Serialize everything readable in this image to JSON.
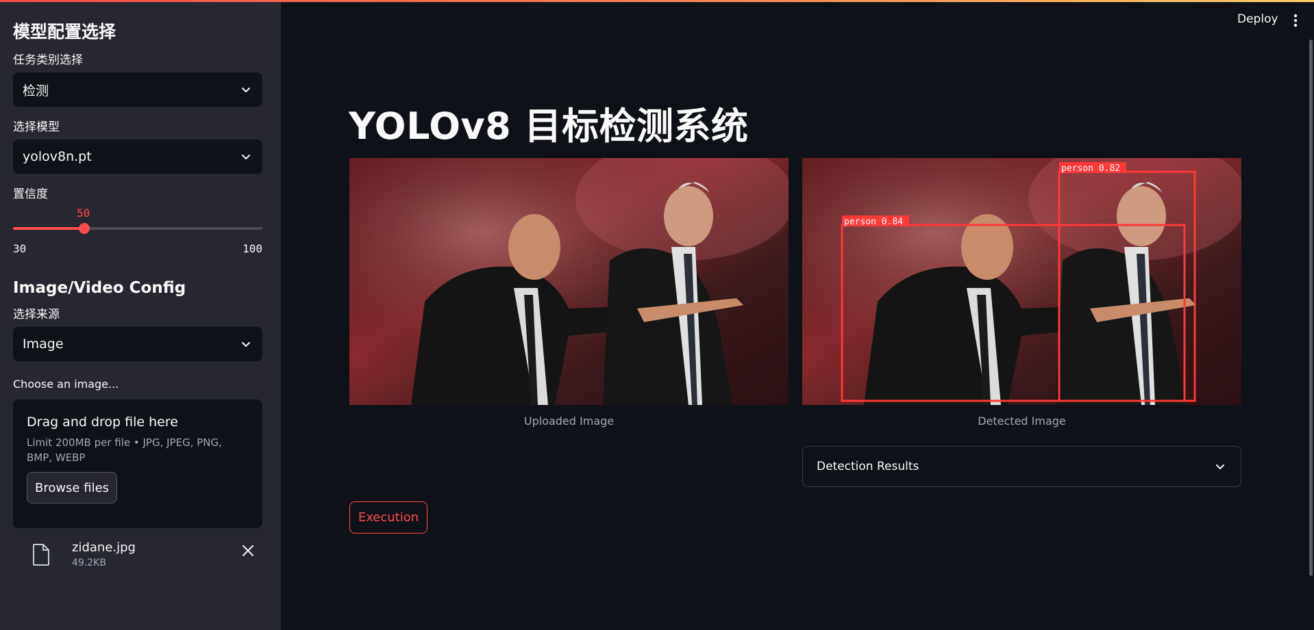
{
  "sidebar": {
    "model_heading": "模型配置选择",
    "task_label": "任务类别选择",
    "task_value": "检测",
    "model_label": "选择模型",
    "model_value": "yolov8n.pt",
    "conf_label": "置信度",
    "conf_value": "50",
    "conf_min": "30",
    "conf_max": "100",
    "conf_fraction": 0.2857,
    "source_heading": "Image/Video Config",
    "source_label": "选择来源",
    "source_value": "Image",
    "uploader_label": "Choose an image...",
    "uploader_title": "Drag and drop file here",
    "uploader_hint": "Limit 200MB per file • JPG, JPEG, PNG, BMP, WEBP",
    "browse_label": "Browse files",
    "file_name": "zidane.jpg",
    "file_size": "49.2KB"
  },
  "header": {
    "deploy_label": "Deploy"
  },
  "main": {
    "title": "YOLOv8 目标检测系统",
    "uploaded_caption": "Uploaded Image",
    "detected_caption": "Detected Image",
    "detections": [
      {
        "label": "person 0.84"
      },
      {
        "label": "person 0.82"
      }
    ],
    "results_label": "Detection Results",
    "execute_label": "Execution"
  },
  "colors": {
    "accent": "#ff4b4b",
    "bbox": "#ff3838"
  }
}
